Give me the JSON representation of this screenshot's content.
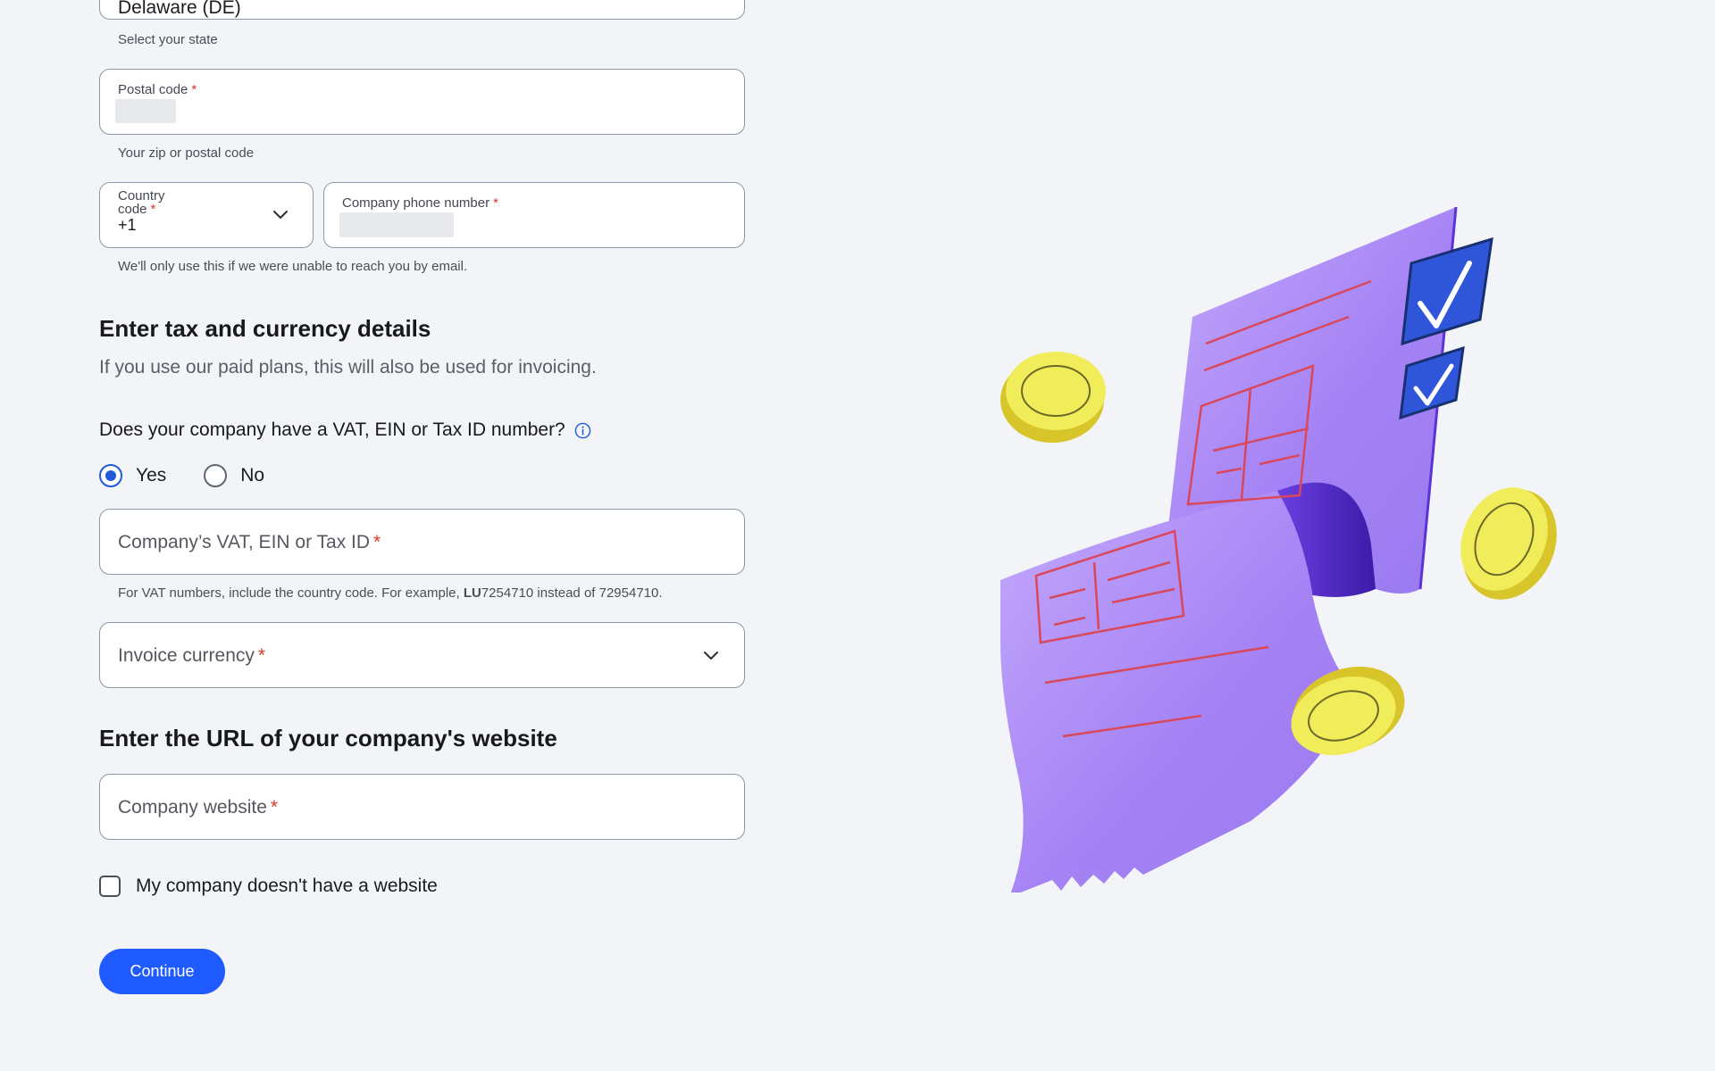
{
  "state": {
    "value": "Delaware (DE)",
    "helper": "Select your state"
  },
  "postal": {
    "label": "Postal code",
    "required": "*",
    "helper": "Your zip or postal code"
  },
  "country_code": {
    "label_line1": "Country",
    "label_line2": "code",
    "required": "*",
    "value": "+1"
  },
  "phone": {
    "label": "Company phone number",
    "required": "*",
    "helper": "We'll only use this if we were unable to reach you by email."
  },
  "tax_section": {
    "heading": "Enter tax and currency details",
    "subtitle": "If you use our paid plans, this will also be used for invoicing.",
    "question": "Does your company have a VAT, EIN or Tax ID number?",
    "options": [
      "Yes",
      "No"
    ],
    "selected": "Yes",
    "tax_id_label": "Company’s VAT, EIN or Tax ID",
    "tax_id_required": "*",
    "tax_help_prefix": "For VAT numbers, include the country code. For example, ",
    "tax_help_bold": "LU",
    "tax_help_suffix": "7254710 instead of 72954710.",
    "currency_label": "Invoice currency",
    "currency_required": "*"
  },
  "website_section": {
    "heading": "Enter the URL of your company's website",
    "website_label": "Company website",
    "website_required": "*",
    "no_website_label": "My company doesn't have a website",
    "no_website_checked": false
  },
  "continue_label": "Continue",
  "colors": {
    "accent": "#1f5bff",
    "required": "#d9362b",
    "background": "#f3f4f8"
  }
}
